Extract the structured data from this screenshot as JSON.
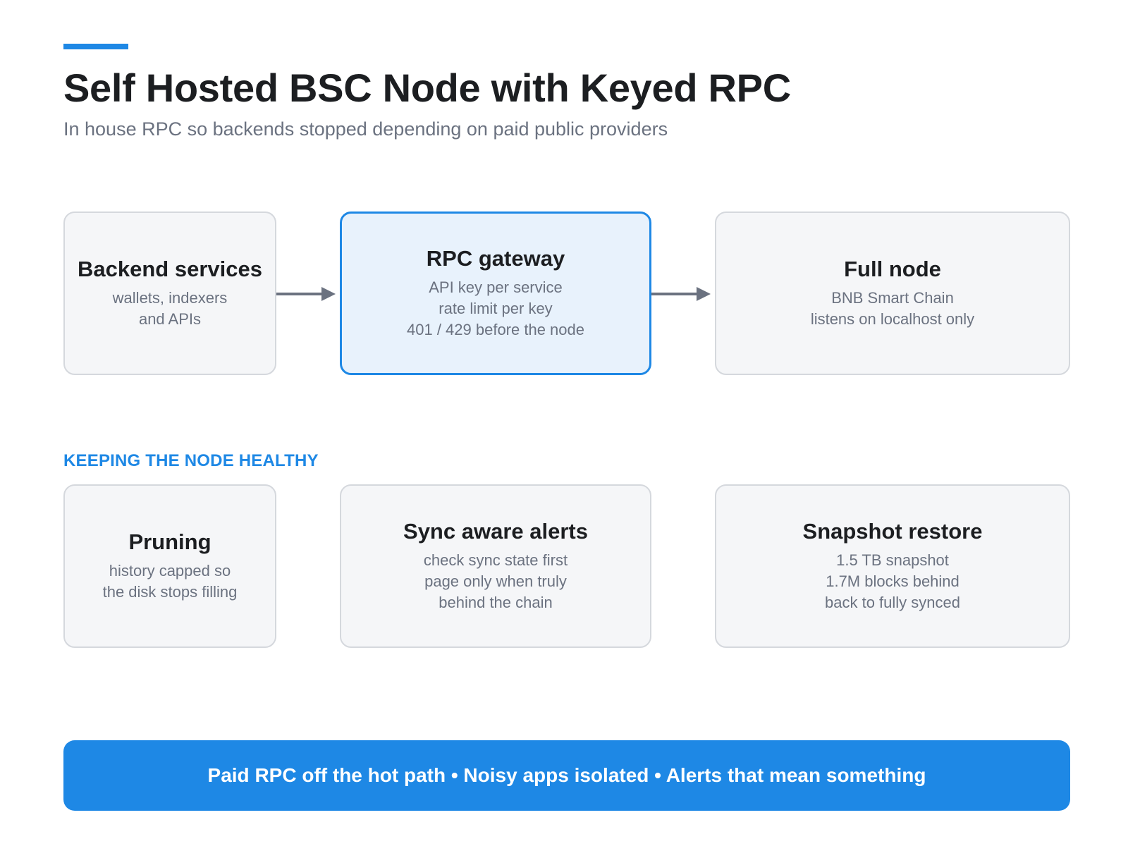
{
  "header": {
    "title": "Self Hosted BSC Node with Keyed RPC",
    "subtitle": "In house RPC so backends stopped depending on paid public providers"
  },
  "flow": {
    "backend": {
      "title": "Backend services",
      "lines": [
        "wallets, indexers",
        "and APIs"
      ]
    },
    "gateway": {
      "title": "RPC gateway",
      "lines": [
        "API key per service",
        "rate limit per key",
        "401 / 429 before the node"
      ]
    },
    "node": {
      "title": "Full node",
      "lines": [
        "BNB Smart Chain",
        "listens on localhost only"
      ]
    }
  },
  "health": {
    "label": "KEEPING THE NODE HEALTHY",
    "pruning": {
      "title": "Pruning",
      "lines": [
        "history capped so",
        "the disk stops filling"
      ]
    },
    "alerts": {
      "title": "Sync aware alerts",
      "lines": [
        "check sync state first",
        "page only when truly",
        "behind the chain"
      ]
    },
    "snapshot": {
      "title": "Snapshot restore",
      "lines": [
        "1.5 TB snapshot",
        "1.7M blocks behind",
        "back to fully synced"
      ]
    }
  },
  "footer": {
    "text": "Paid RPC off the hot path • Noisy apps isolated • Alerts that mean something"
  },
  "colors": {
    "accent": "#1e88e5",
    "box_fill": "#f5f6f8",
    "box_border": "#d5d8dd",
    "highlight_fill": "#e8f2fc",
    "arrow": "#6b7280"
  },
  "icons": {
    "connector": "arrow-right-icon"
  }
}
